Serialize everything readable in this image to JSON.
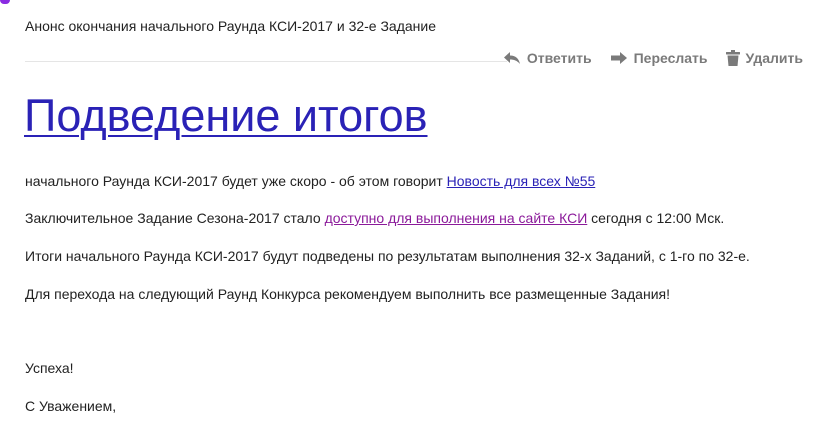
{
  "email": {
    "subject": "Анонс окончания начального Раунда КСИ-2017 и 32-е Задание",
    "actions": {
      "reply_label": "Ответить",
      "forward_label": "Переслать",
      "delete_label": "Удалить"
    },
    "headline": "Подведение итогов",
    "paragraph1": {
      "text": "начального Раунда КСИ-2017 будет уже скоро - об этом говорит",
      "link": "Новость для всех №55"
    },
    "paragraph2": {
      "before": "Заключительное Задание Сезона-2017 стало",
      "link": "доступно для выполнения на сайте КСИ",
      "after": "сегодня с 12:00 Мск."
    },
    "paragraph3": "Итоги начального Раунда КСИ-2017 будут подведены по результатам выполнения 32-х Заданий, с 1-го по 32-е.",
    "paragraph4": "Для перехода на следующий Раунд Конкурса рекомендуем выполнить все размещенные Задания!",
    "closing1": "Успеха!",
    "closing2": "С Уважением,"
  },
  "colors": {
    "link_blue": "#2a22b6",
    "link_visited": "#8b1a9a",
    "action_gray": "#7a7a7a",
    "accent": "#8a2be2"
  },
  "icons": {
    "reply": "reply-arrow-icon",
    "forward": "forward-arrow-icon",
    "delete": "trash-icon"
  }
}
